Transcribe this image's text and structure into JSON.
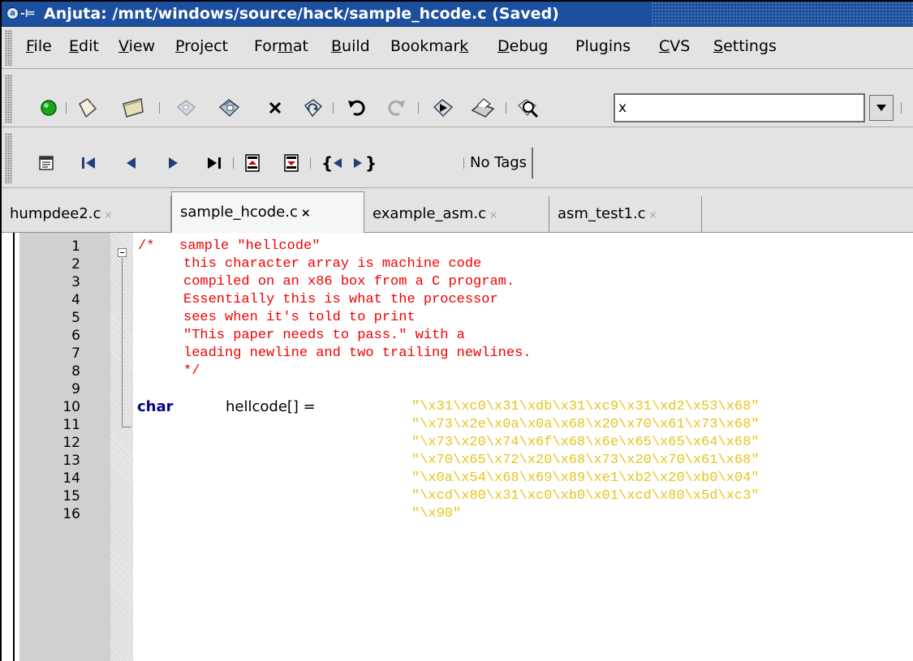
{
  "window": {
    "title": "Anjuta: /mnt/windows/source/hack/sample_hcode.c (Saved)"
  },
  "menubar": {
    "items": [
      {
        "pre": "",
        "mn": "F",
        "post": "ile"
      },
      {
        "pre": "",
        "mn": "E",
        "post": "dit"
      },
      {
        "pre": "",
        "mn": "V",
        "post": "iew"
      },
      {
        "pre": "",
        "mn": "P",
        "post": "roject"
      },
      {
        "pre": "For",
        "mn": "m",
        "post": "at"
      },
      {
        "pre": "",
        "mn": "B",
        "post": "uild"
      },
      {
        "pre": "Bookmar",
        "mn": "k",
        "post": ""
      },
      {
        "pre": "",
        "mn": "D",
        "post": "ebug"
      },
      {
        "pre": "Plu",
        "mn": "g",
        "post": "ins"
      },
      {
        "pre": "",
        "mn": "C",
        "post": "VS"
      },
      {
        "pre": "",
        "mn": "S",
        "post": "ettings"
      }
    ]
  },
  "toolbar": {
    "search_value": "x",
    "tag_label": "No Tags"
  },
  "tabs": [
    {
      "label": "humpdee2.c",
      "close": "×"
    },
    {
      "label": "sample_hcode.c",
      "close": "×"
    },
    {
      "label": "example_asm.c",
      "close": "×"
    },
    {
      "label": "asm_test1.c",
      "close": "×"
    }
  ],
  "editor": {
    "line_numbers": [
      "1",
      "2",
      "3",
      "4",
      "5",
      "6",
      "7",
      "8",
      "9",
      "10",
      "11",
      "12",
      "13",
      "14",
      "15",
      "16"
    ],
    "comment_lines": [
      "/*   sample \"hellcode\"",
      "this character array is machine code",
      "compiled on an x86 box from a C program.",
      "Essentially this is what the processor",
      "sees when it's told to print",
      "\"This paper needs to pass.\" with a",
      "leading newline and two trailing newlines.",
      "*/"
    ],
    "keyword": "char",
    "identifier": "hellcode[] =",
    "string_lines": [
      "\"\\x31\\xc0\\x31\\xdb\\x31\\xc9\\x31\\xd2\\x53\\x68\"",
      "\"\\x73\\x2e\\x0a\\x0a\\x68\\x20\\x70\\x61\\x73\\x68\"",
      "\"\\x73\\x20\\x74\\x6f\\x68\\x6e\\x65\\x65\\x64\\x68\"",
      "\"\\x70\\x65\\x72\\x20\\x68\\x73\\x20\\x70\\x61\\x68\"",
      "\"\\x0a\\x54\\x68\\x69\\x89\\xe1\\xb2\\x20\\xb0\\x04\"",
      "\"\\xcd\\x80\\x31\\xc0\\xb0\\x01\\xcd\\x80\\x5d\\xc3\"",
      "\"\\x90\""
    ]
  },
  "colors": {
    "titlebar": "#1c4f9e",
    "comment": "#f00000",
    "string": "#e6c41e",
    "keyword": "#06068a",
    "gutter": "#d0d0d0"
  }
}
